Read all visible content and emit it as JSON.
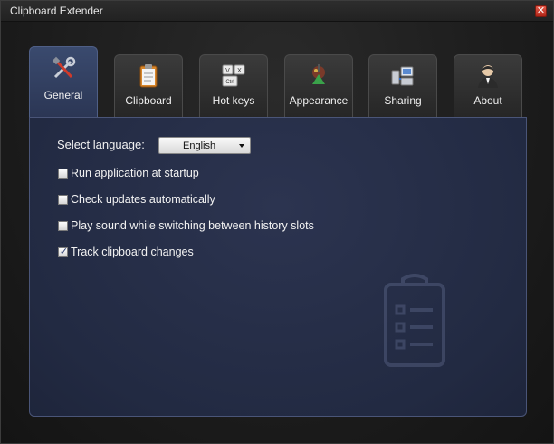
{
  "window": {
    "title": "Clipboard Extender",
    "close_glyph": "✕"
  },
  "tabs": [
    {
      "label": "General",
      "icon": "tools-icon",
      "active": true
    },
    {
      "label": "Clipboard",
      "icon": "clipboard-icon",
      "active": false
    },
    {
      "label": "Hot keys",
      "icon": "keyboard-keys-icon",
      "active": false
    },
    {
      "label": "Appearance",
      "icon": "paint-brush-icon",
      "active": false
    },
    {
      "label": "Sharing",
      "icon": "network-computers-icon",
      "active": false
    },
    {
      "label": "About",
      "icon": "person-icon",
      "active": false
    }
  ],
  "general": {
    "language_label": "Select language:",
    "language_value": "English",
    "options": [
      {
        "label": "Run application at startup",
        "checked": false
      },
      {
        "label": "Check updates automatically",
        "checked": false
      },
      {
        "label": "Play sound while switching between history slots",
        "checked": false
      },
      {
        "label": "Track clipboard changes",
        "checked": true
      }
    ],
    "check_glyph": "✓"
  },
  "hotkey_icon_text": {
    "top_left": "V",
    "top_right": "X",
    "bottom": "Ctrl"
  },
  "colors": {
    "active_tab": "#3a4a6e",
    "panel": "#222a42",
    "close_button": "#c83a2b"
  }
}
